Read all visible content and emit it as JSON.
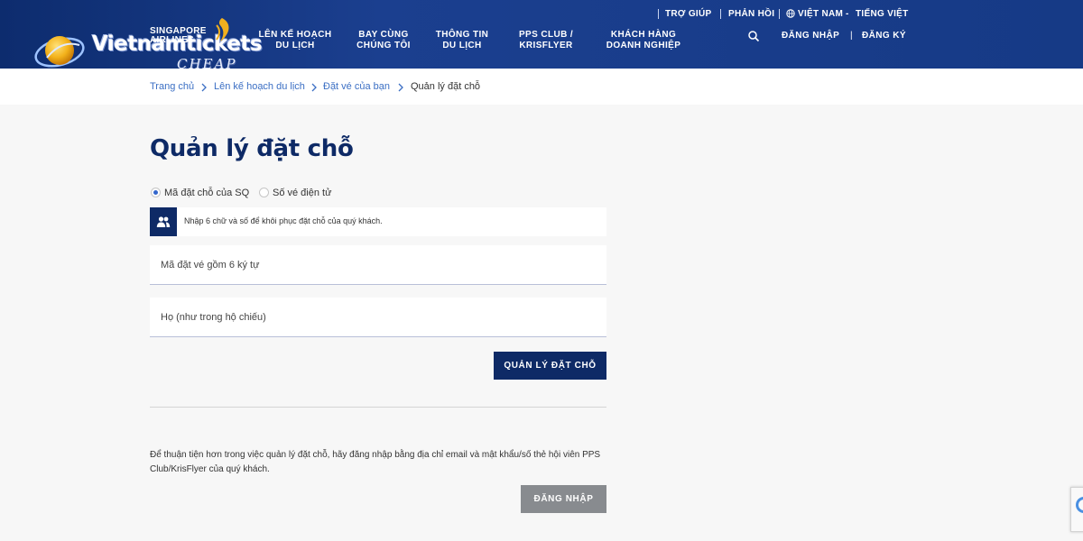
{
  "header": {
    "logo_brand": "Vietnamtickets",
    "logo_sub": "CHEAP",
    "sq_logo_line1": "SINGAPORE",
    "sq_logo_line2": "AIRLINES",
    "utility": {
      "help": "TRỢ GIÚP",
      "feedback": "PHẢN HỒI",
      "region": "VIỆT NAM",
      "language_sep": "-",
      "language": "TIẾNG VIỆT"
    },
    "nav": [
      {
        "line1": "LÊN KẾ HOẠCH",
        "line2": "DU LỊCH"
      },
      {
        "line1": "BAY CÙNG",
        "line2": "CHÚNG TÔI"
      },
      {
        "line1": "THÔNG TIN",
        "line2": "DU LỊCH"
      },
      {
        "line1": "PPS CLUB /",
        "line2": "KRISFLYER"
      },
      {
        "line1": "KHÁCH HÀNG",
        "line2": "DOANH NGHIỆP"
      }
    ],
    "login": "ĐĂNG NHẬP",
    "auth_sep": "|",
    "register": "ĐĂNG KÝ"
  },
  "breadcrumb": [
    "Trang chủ",
    "Lên kế hoạch du lịch",
    "Đặt vé của bạn",
    "Quản lý đặt chỗ"
  ],
  "main": {
    "title": "Quản lý đặt chỗ",
    "radio_options": [
      {
        "label": "Mã đặt chỗ của SQ",
        "selected": true
      },
      {
        "label": "Số vé điện tử",
        "selected": false
      }
    ],
    "info_text": "Nhập 6 chữ và số để khôi phục đặt chỗ của quý khách.",
    "booking_code_placeholder": "Mã đặt vé gồm 6 ký tự",
    "last_name_placeholder": "Họ (như trong hộ chiếu)",
    "manage_button": "QUẢN LÝ ĐẶT CHỖ",
    "login_note": "Để thuận tiện hơn trong việc quản lý đặt chỗ, hãy đăng nhập bằng địa chỉ email và mật khẩu/số thẻ hội viên PPS Club/KrisFlyer của quý khách.",
    "login_button": "ĐĂNG NHẬP"
  },
  "colors": {
    "header_bg": "#163a86",
    "primary_navy": "#0e2a66",
    "link_blue": "#3b6fc4",
    "secondary_grey": "#888b8f",
    "page_bg": "#f7f7f7"
  },
  "icons": [
    "globe-logo-icon",
    "singapore-bird-icon",
    "globe-icon",
    "search-icon",
    "chevron-right-icon",
    "users-icon",
    "recaptcha-icon"
  ]
}
